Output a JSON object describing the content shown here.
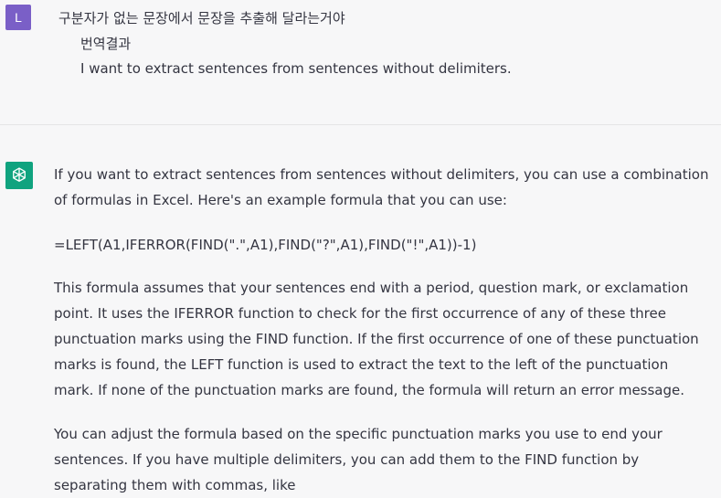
{
  "user": {
    "avatar_letter": "L",
    "message": "구분자가 없는 문장에서 문장을 추출해 달라는거야",
    "translation_label": "번역결과",
    "translation": "I want to extract sentences from sentences without delimiters."
  },
  "assistant": {
    "icon": "openai-logo-icon",
    "paragraphs": [
      "If you want to extract sentences from sentences without delimiters, you can use a combination of formulas in Excel. Here's an example formula that you can use:",
      "=LEFT(A1,IFERROR(FIND(\".\",A1),FIND(\"?\",A1),FIND(\"!\",A1))-1)",
      "This formula assumes that your sentences end with a period, question mark, or exclamation point. It uses the IFERROR function to check for the first occurrence of any of these three punctuation marks using the FIND function. If the first occurrence of one of these punctuation marks is found, the LEFT function is used to extract the text to the left of the punctuation mark. If none of the punctuation marks are found, the formula will return an error message.",
      "You can adjust the formula based on the specific punctuation marks you use to end your sentences. If you have multiple delimiters, you can add them to the FIND function by separating them with commas, like"
    ]
  },
  "colors": {
    "user_avatar": "#7a5fc7",
    "assistant_avatar": "#10a37f",
    "background": "#f7f7f8",
    "text": "#343541"
  }
}
